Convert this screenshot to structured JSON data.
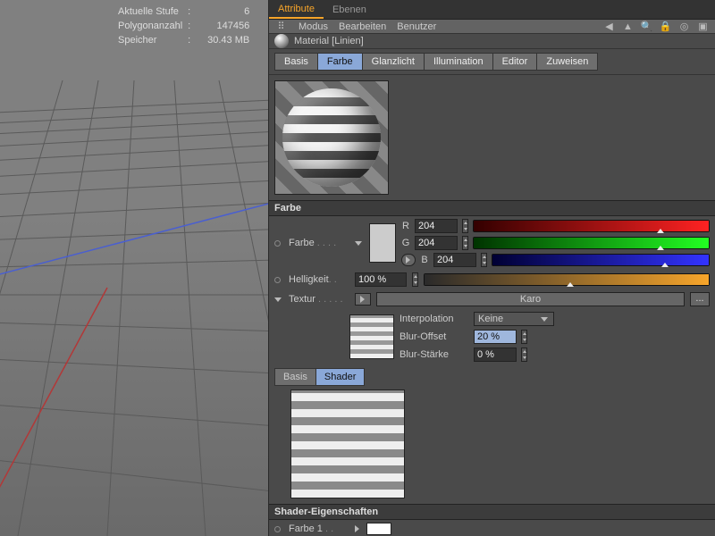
{
  "viewport": {
    "stats": {
      "level_label": "Aktuelle Stufe",
      "level_value": "6",
      "polycount_label": "Polygonanzahl",
      "polycount_value": "147456",
      "memory_label": "Speicher",
      "memory_value": "30.43 MB"
    }
  },
  "panel": {
    "tabs": {
      "attribute": "Attribute",
      "layers": "Ebenen"
    },
    "menus": {
      "mode": "Modus",
      "edit": "Bearbeiten",
      "user": "Benutzer"
    },
    "header": "Material [Linien]",
    "channels": {
      "basis": "Basis",
      "farbe": "Farbe",
      "glanzlicht": "Glanzlicht",
      "illumination": "Illumination",
      "editor": "Editor",
      "zuweisen": "Zuweisen"
    },
    "color": {
      "section": "Farbe",
      "label": "Farbe",
      "r": "R",
      "r_val": "204",
      "g": "G",
      "g_val": "204",
      "b": "B",
      "b_val": "204",
      "brightness_label": "Helligkeit",
      "brightness_val": "100 %"
    },
    "tex": {
      "label": "Textur",
      "button": "Karo",
      "browse": "...",
      "interp_label": "Interpolation",
      "interp_val": "Keine",
      "blurOffset_label": "Blur-Offset",
      "blurOffset_val": "20 %",
      "blurStrength_label": "Blur-Stärke",
      "blurStrength_val": "0 %"
    },
    "shader": {
      "tab_basis": "Basis",
      "tab_shader": "Shader",
      "section": "Shader-Eigenschaften",
      "color1_label": "Farbe 1"
    }
  }
}
